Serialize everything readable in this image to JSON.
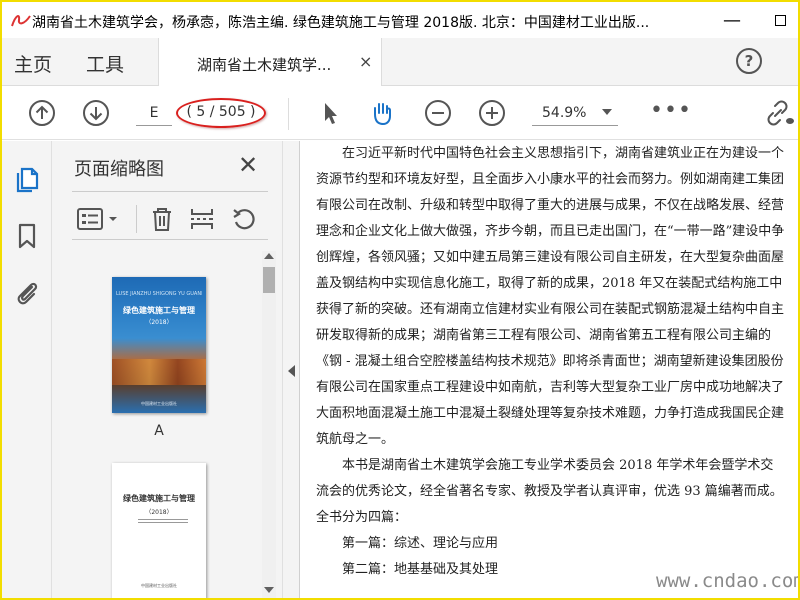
{
  "window": {
    "title": "湖南省土木建筑学会，杨承悫，陈浩主编. 绿色建筑施工与管理 2018版. 北京：中国建材工业出版...",
    "minimize_label": "—"
  },
  "tabs": {
    "home": "主页",
    "tools": "工具",
    "document_tab": "湖南省土木建筑学...",
    "close_glyph": "×",
    "help_glyph": "?"
  },
  "toolbar": {
    "page_input_value": "E",
    "page_count": "( 5 / 505 )",
    "zoom": "54.9%",
    "more": "•••"
  },
  "panel": {
    "title": "页面缩略图",
    "close_glyph": "✕",
    "thumbnails": [
      {
        "label": "A",
        "cover_top": "LÜSE JIANZHU SHIGONG YU GUANLI",
        "cover_title": "绿色建筑施工与管理",
        "cover_year": "（2018）",
        "cover_publisher": "中国建材工业出版社"
      },
      {
        "title": "绿色建筑施工与管理",
        "year": "（2018）",
        "publisher": "中国建材工业出版社"
      }
    ]
  },
  "document": {
    "paragraphs": [
      "在习近平新时代中国特色社会主义思想指引下，湖南省建筑业正在为建设一个资源节约型和环境友好型，且全面步入小康水平的社会而努力。例如湖南建工集团有限公司在改制、升级和转型中取得了重大的进展与成果，不仅在战略发展、经营理念和企业文化上做大做强，齐步今朝，而且已走出国门，在“一带一路”建设中争创辉煌，各领风骚；又如中建五局第三建设有限公司自主研发，在大型复杂曲面屋盖及钢结构中实现信息化施工，取得了新的成果，2018 年又在装配式结构施工中获得了新的突破。还有湖南立信建材实业有限公司在装配式钢筋混凝土结构中自主研发取得新的成果；湖南省第三工程有限公司、湖南省第五工程有限公司主编的《钢 - 混凝土组合空腔楼盖结构技术规范》即将杀青面世；湖南望新建设集团股份有限公司在国家重点工程建设中如南航，吉利等大型复杂工业厂房中成功地解决了大面积地面混凝土施工中混凝土裂缝处理等复杂技术难题，力争打造成我国民企建筑航母之一。",
      "本书是湖南省土木建筑学会施工专业学术委员会 2018 年学术年会暨学术交流会的优秀论文，经全省著名专家、教授及学者认真评审，优选 93 篇编著而成。全书分为四篇："
    ],
    "toc": [
      "第一篇：综述、理论与应用",
      "第二篇：地基基础及其处理"
    ]
  },
  "watermark": "www.cndao.com",
  "colors": {
    "frame": "#f2dd00",
    "annotation_ring": "#d9201e",
    "accent_blue": "#1a73c8"
  },
  "icons": [
    "app-icon",
    "up-arrow-icon",
    "down-arrow-icon",
    "select-cursor-icon",
    "hand-tool-icon",
    "zoom-out-icon",
    "zoom-in-icon",
    "link-icon",
    "pages-icon",
    "bookmark-icon",
    "attachment-icon",
    "options-icon",
    "delete-icon",
    "insert-page-icon",
    "rotate-icon"
  ]
}
